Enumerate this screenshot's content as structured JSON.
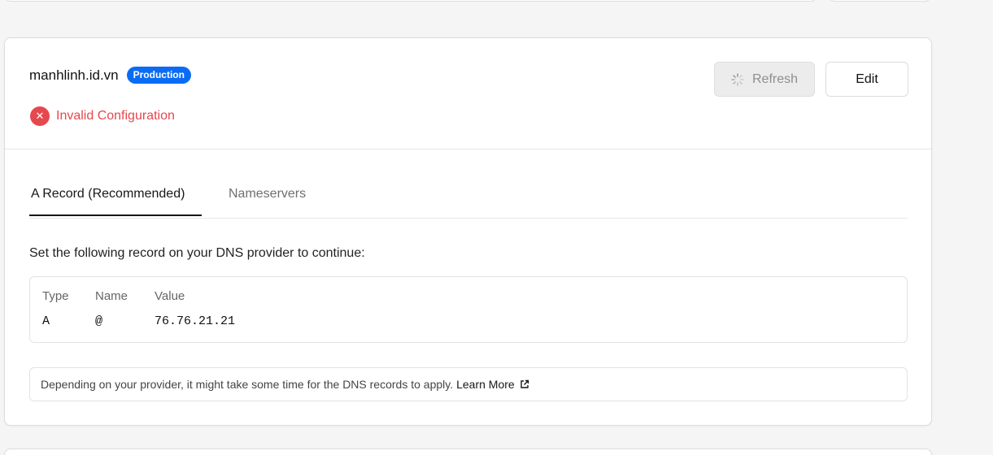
{
  "domain": {
    "name": "manhlinh.id.vn",
    "badge": "Production",
    "status_icon": "x-circle-icon",
    "status_text": "Invalid Configuration",
    "status_color": "#e5484d",
    "badge_color": "#0a6cf5"
  },
  "actions": {
    "refresh_label": "Refresh",
    "refresh_icon": "spinner-icon",
    "edit_label": "Edit"
  },
  "tabs": [
    {
      "label": "A Record (Recommended)",
      "active": true
    },
    {
      "label": "Nameservers",
      "active": false
    }
  ],
  "instructions": "Set the following record on your DNS provider to continue:",
  "records": {
    "headers": [
      "Type",
      "Name",
      "Value"
    ],
    "rows": [
      [
        "A",
        "@",
        "76.76.21.21"
      ]
    ]
  },
  "note": {
    "text": "Depending on your provider, it might take some time for the DNS records to apply.",
    "link_label": "Learn More",
    "link_icon": "external-link-icon"
  }
}
